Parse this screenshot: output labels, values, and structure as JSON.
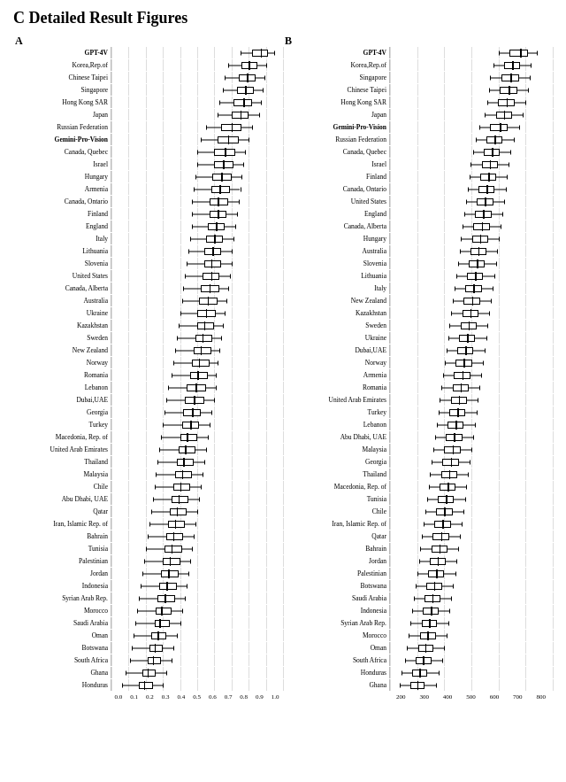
{
  "title": "C   Detailed Result Figures",
  "panelA": {
    "label": "A",
    "xAxis": [
      "0.0",
      "0.1",
      "0.2",
      "0.3",
      "0.4",
      "0.5",
      "0.6",
      "0.7",
      "0.8",
      "0.9",
      "1.0"
    ],
    "rows": [
      {
        "label": "GPT-4V",
        "q1": 0.82,
        "median": 0.87,
        "q3": 0.91,
        "wlo": 0.75,
        "whi": 0.95,
        "highlight": true
      },
      {
        "label": "Korea,Rep.of",
        "q1": 0.76,
        "median": 0.8,
        "q3": 0.85,
        "wlo": 0.68,
        "whi": 0.9
      },
      {
        "label": "Chinese Taipei",
        "q1": 0.74,
        "median": 0.79,
        "q3": 0.84,
        "wlo": 0.66,
        "whi": 0.89
      },
      {
        "label": "Singapore",
        "q1": 0.73,
        "median": 0.78,
        "q3": 0.83,
        "wlo": 0.65,
        "whi": 0.88
      },
      {
        "label": "Hong Kong SAR",
        "q1": 0.71,
        "median": 0.77,
        "q3": 0.82,
        "wlo": 0.63,
        "whi": 0.87
      },
      {
        "label": "Japan",
        "q1": 0.7,
        "median": 0.75,
        "q3": 0.8,
        "wlo": 0.62,
        "whi": 0.86
      },
      {
        "label": "Russian Federation",
        "q1": 0.64,
        "median": 0.7,
        "q3": 0.76,
        "wlo": 0.55,
        "whi": 0.82
      },
      {
        "label": "Gemini-Pro-Vision",
        "q1": 0.62,
        "median": 0.68,
        "q3": 0.74,
        "wlo": 0.52,
        "whi": 0.8,
        "highlight": true
      },
      {
        "label": "Canada, Quebec",
        "q1": 0.6,
        "median": 0.66,
        "q3": 0.72,
        "wlo": 0.5,
        "whi": 0.78
      },
      {
        "label": "Israel",
        "q1": 0.6,
        "median": 0.65,
        "q3": 0.71,
        "wlo": 0.5,
        "whi": 0.77
      },
      {
        "label": "Hungary",
        "q1": 0.59,
        "median": 0.64,
        "q3": 0.7,
        "wlo": 0.49,
        "whi": 0.76
      },
      {
        "label": "Armenia",
        "q1": 0.58,
        "median": 0.63,
        "q3": 0.69,
        "wlo": 0.48,
        "whi": 0.75
      },
      {
        "label": "Canada, Ontario",
        "q1": 0.57,
        "median": 0.62,
        "q3": 0.68,
        "wlo": 0.47,
        "whi": 0.74
      },
      {
        "label": "Finland",
        "q1": 0.57,
        "median": 0.62,
        "q3": 0.67,
        "wlo": 0.47,
        "whi": 0.73
      },
      {
        "label": "England",
        "q1": 0.56,
        "median": 0.61,
        "q3": 0.66,
        "wlo": 0.47,
        "whi": 0.72
      },
      {
        "label": "Italy",
        "q1": 0.55,
        "median": 0.6,
        "q3": 0.65,
        "wlo": 0.46,
        "whi": 0.71
      },
      {
        "label": "Lithuania",
        "q1": 0.54,
        "median": 0.59,
        "q3": 0.64,
        "wlo": 0.45,
        "whi": 0.7
      },
      {
        "label": "Slovenia",
        "q1": 0.54,
        "median": 0.58,
        "q3": 0.64,
        "wlo": 0.44,
        "whi": 0.7
      },
      {
        "label": "United States",
        "q1": 0.53,
        "median": 0.58,
        "q3": 0.63,
        "wlo": 0.43,
        "whi": 0.69
      },
      {
        "label": "Canada, Alberta",
        "q1": 0.52,
        "median": 0.57,
        "q3": 0.63,
        "wlo": 0.42,
        "whi": 0.68
      },
      {
        "label": "Australia",
        "q1": 0.51,
        "median": 0.56,
        "q3": 0.62,
        "wlo": 0.41,
        "whi": 0.67
      },
      {
        "label": "Ukraine",
        "q1": 0.5,
        "median": 0.55,
        "q3": 0.61,
        "wlo": 0.4,
        "whi": 0.66
      },
      {
        "label": "Kazakhstan",
        "q1": 0.5,
        "median": 0.54,
        "q3": 0.6,
        "wlo": 0.39,
        "whi": 0.65
      },
      {
        "label": "Sweden",
        "q1": 0.49,
        "median": 0.53,
        "q3": 0.59,
        "wlo": 0.38,
        "whi": 0.64
      },
      {
        "label": "New Zealand",
        "q1": 0.48,
        "median": 0.52,
        "q3": 0.58,
        "wlo": 0.37,
        "whi": 0.63
      },
      {
        "label": "Norway",
        "q1": 0.47,
        "median": 0.51,
        "q3": 0.57,
        "wlo": 0.36,
        "whi": 0.62
      },
      {
        "label": "Romania",
        "q1": 0.46,
        "median": 0.5,
        "q3": 0.56,
        "wlo": 0.35,
        "whi": 0.61
      },
      {
        "label": "Lebanon",
        "q1": 0.44,
        "median": 0.49,
        "q3": 0.55,
        "wlo": 0.33,
        "whi": 0.61
      },
      {
        "label": "Dubai,UAE",
        "q1": 0.43,
        "median": 0.48,
        "q3": 0.54,
        "wlo": 0.32,
        "whi": 0.6
      },
      {
        "label": "Georgia",
        "q1": 0.42,
        "median": 0.47,
        "q3": 0.52,
        "wlo": 0.31,
        "whi": 0.58
      },
      {
        "label": "Turkey",
        "q1": 0.41,
        "median": 0.46,
        "q3": 0.51,
        "wlo": 0.3,
        "whi": 0.57
      },
      {
        "label": "Macedonia, Rep. of",
        "q1": 0.4,
        "median": 0.44,
        "q3": 0.5,
        "wlo": 0.29,
        "whi": 0.56
      },
      {
        "label": "United Arab Emirates",
        "q1": 0.39,
        "median": 0.43,
        "q3": 0.49,
        "wlo": 0.28,
        "whi": 0.55
      },
      {
        "label": "Thailand",
        "q1": 0.38,
        "median": 0.42,
        "q3": 0.48,
        "wlo": 0.27,
        "whi": 0.54
      },
      {
        "label": "Malaysia",
        "q1": 0.37,
        "median": 0.41,
        "q3": 0.47,
        "wlo": 0.26,
        "whi": 0.53
      },
      {
        "label": "Chile",
        "q1": 0.36,
        "median": 0.4,
        "q3": 0.46,
        "wlo": 0.25,
        "whi": 0.52
      },
      {
        "label": "Abu Dhabi, UAE",
        "q1": 0.35,
        "median": 0.39,
        "q3": 0.45,
        "wlo": 0.24,
        "whi": 0.51
      },
      {
        "label": "Qatar",
        "q1": 0.34,
        "median": 0.38,
        "q3": 0.44,
        "wlo": 0.23,
        "whi": 0.5
      },
      {
        "label": "Iran, Islamic Rep. of",
        "q1": 0.33,
        "median": 0.37,
        "q3": 0.43,
        "wlo": 0.22,
        "whi": 0.49
      },
      {
        "label": "Bahrain",
        "q1": 0.32,
        "median": 0.36,
        "q3": 0.42,
        "wlo": 0.21,
        "whi": 0.48
      },
      {
        "label": "Tunisia",
        "q1": 0.31,
        "median": 0.35,
        "q3": 0.41,
        "wlo": 0.2,
        "whi": 0.47
      },
      {
        "label": "Palestinian",
        "q1": 0.3,
        "median": 0.34,
        "q3": 0.4,
        "wlo": 0.19,
        "whi": 0.46
      },
      {
        "label": "Jordan",
        "q1": 0.29,
        "median": 0.33,
        "q3": 0.39,
        "wlo": 0.18,
        "whi": 0.45
      },
      {
        "label": "Indonesia",
        "q1": 0.28,
        "median": 0.32,
        "q3": 0.38,
        "wlo": 0.17,
        "whi": 0.44
      },
      {
        "label": "Syrian Arab Rep.",
        "q1": 0.27,
        "median": 0.31,
        "q3": 0.37,
        "wlo": 0.16,
        "whi": 0.43
      },
      {
        "label": "Morocco",
        "q1": 0.26,
        "median": 0.29,
        "q3": 0.35,
        "wlo": 0.15,
        "whi": 0.41
      },
      {
        "label": "Saudi Arabia",
        "q1": 0.25,
        "median": 0.28,
        "q3": 0.34,
        "wlo": 0.14,
        "whi": 0.4
      },
      {
        "label": "Oman",
        "q1": 0.23,
        "median": 0.27,
        "q3": 0.32,
        "wlo": 0.13,
        "whi": 0.38
      },
      {
        "label": "Botswana",
        "q1": 0.22,
        "median": 0.25,
        "q3": 0.3,
        "wlo": 0.12,
        "whi": 0.36
      },
      {
        "label": "South Africa",
        "q1": 0.21,
        "median": 0.24,
        "q3": 0.29,
        "wlo": 0.11,
        "whi": 0.35
      },
      {
        "label": "Ghana",
        "q1": 0.18,
        "median": 0.21,
        "q3": 0.26,
        "wlo": 0.08,
        "whi": 0.32
      },
      {
        "label": "Honduras",
        "q1": 0.16,
        "median": 0.19,
        "q3": 0.24,
        "wlo": 0.06,
        "whi": 0.3
      }
    ]
  },
  "panelB": {
    "label": "B",
    "xAxis": [
      "200",
      "300",
      "400",
      "500",
      "600",
      "700",
      "800"
    ],
    "xMin": 200,
    "xMax": 800,
    "rows": [
      {
        "label": "GPT-4V",
        "q1": 640,
        "median": 680,
        "q3": 710,
        "wlo": 600,
        "whi": 740,
        "highlight": true
      },
      {
        "label": "Korea,Rep.of",
        "q1": 620,
        "median": 650,
        "q3": 680,
        "wlo": 580,
        "whi": 720
      },
      {
        "label": "Singapore",
        "q1": 610,
        "median": 645,
        "q3": 675,
        "wlo": 570,
        "whi": 715
      },
      {
        "label": "Chinese Taipei",
        "q1": 605,
        "median": 638,
        "q3": 668,
        "wlo": 565,
        "whi": 708
      },
      {
        "label": "Hong Kong SAR",
        "q1": 598,
        "median": 630,
        "q3": 660,
        "wlo": 558,
        "whi": 700
      },
      {
        "label": "Japan",
        "q1": 590,
        "median": 620,
        "q3": 650,
        "wlo": 550,
        "whi": 690
      },
      {
        "label": "Gemini-Pro-Vision",
        "q1": 570,
        "median": 605,
        "q3": 635,
        "wlo": 530,
        "whi": 675,
        "highlight": true
      },
      {
        "label": "Russian Federation",
        "q1": 555,
        "median": 585,
        "q3": 615,
        "wlo": 515,
        "whi": 655
      },
      {
        "label": "Canada, Quebec",
        "q1": 545,
        "median": 575,
        "q3": 605,
        "wlo": 505,
        "whi": 645
      },
      {
        "label": "Israel",
        "q1": 538,
        "median": 568,
        "q3": 598,
        "wlo": 498,
        "whi": 638
      },
      {
        "label": "Finland",
        "q1": 532,
        "median": 562,
        "q3": 592,
        "wlo": 492,
        "whi": 632
      },
      {
        "label": "Canada, Ontario",
        "q1": 526,
        "median": 556,
        "q3": 586,
        "wlo": 486,
        "whi": 626
      },
      {
        "label": "United States",
        "q1": 520,
        "median": 550,
        "q3": 580,
        "wlo": 480,
        "whi": 620
      },
      {
        "label": "England",
        "q1": 514,
        "median": 544,
        "q3": 574,
        "wlo": 474,
        "whi": 614
      },
      {
        "label": "Canada, Alberta",
        "q1": 508,
        "median": 538,
        "q3": 568,
        "wlo": 468,
        "whi": 608
      },
      {
        "label": "Hungary",
        "q1": 502,
        "median": 532,
        "q3": 562,
        "wlo": 462,
        "whi": 602
      },
      {
        "label": "Australia",
        "q1": 496,
        "median": 526,
        "q3": 556,
        "wlo": 456,
        "whi": 596
      },
      {
        "label": "Slovenia",
        "q1": 490,
        "median": 520,
        "q3": 550,
        "wlo": 450,
        "whi": 590
      },
      {
        "label": "Lithuania",
        "q1": 484,
        "median": 514,
        "q3": 544,
        "wlo": 444,
        "whi": 584
      },
      {
        "label": "Italy",
        "q1": 478,
        "median": 508,
        "q3": 538,
        "wlo": 438,
        "whi": 578
      },
      {
        "label": "New Zealand",
        "q1": 472,
        "median": 502,
        "q3": 532,
        "wlo": 432,
        "whi": 572
      },
      {
        "label": "Kazakhstan",
        "q1": 466,
        "median": 496,
        "q3": 526,
        "wlo": 426,
        "whi": 566
      },
      {
        "label": "Sweden",
        "q1": 460,
        "median": 490,
        "q3": 520,
        "wlo": 420,
        "whi": 560
      },
      {
        "label": "Ukraine",
        "q1": 454,
        "median": 484,
        "q3": 514,
        "wlo": 414,
        "whi": 554
      },
      {
        "label": "Dubai,UAE",
        "q1": 448,
        "median": 478,
        "q3": 508,
        "wlo": 408,
        "whi": 548
      },
      {
        "label": "Norway",
        "q1": 442,
        "median": 472,
        "q3": 502,
        "wlo": 402,
        "whi": 542
      },
      {
        "label": "Armenia",
        "q1": 436,
        "median": 466,
        "q3": 496,
        "wlo": 396,
        "whi": 536
      },
      {
        "label": "Romania",
        "q1": 430,
        "median": 460,
        "q3": 490,
        "wlo": 390,
        "whi": 530
      },
      {
        "label": "United Arab Emirates",
        "q1": 424,
        "median": 454,
        "q3": 484,
        "wlo": 384,
        "whi": 524
      },
      {
        "label": "Turkey",
        "q1": 418,
        "median": 448,
        "q3": 478,
        "wlo": 378,
        "whi": 518
      },
      {
        "label": "Lebanon",
        "q1": 412,
        "median": 442,
        "q3": 472,
        "wlo": 372,
        "whi": 512
      },
      {
        "label": "Abu Dhabi, UAE",
        "q1": 406,
        "median": 436,
        "q3": 466,
        "wlo": 366,
        "whi": 506
      },
      {
        "label": "Malaysia",
        "q1": 400,
        "median": 430,
        "q3": 460,
        "wlo": 360,
        "whi": 500
      },
      {
        "label": "Georgia",
        "q1": 394,
        "median": 424,
        "q3": 454,
        "wlo": 354,
        "whi": 494
      },
      {
        "label": "Thailand",
        "q1": 388,
        "median": 418,
        "q3": 448,
        "wlo": 348,
        "whi": 488
      },
      {
        "label": "Macedonia, Rep. of",
        "q1": 382,
        "median": 412,
        "q3": 442,
        "wlo": 342,
        "whi": 482
      },
      {
        "label": "Tunisia",
        "q1": 376,
        "median": 406,
        "q3": 436,
        "wlo": 336,
        "whi": 476
      },
      {
        "label": "Chile",
        "q1": 370,
        "median": 400,
        "q3": 430,
        "wlo": 330,
        "whi": 470
      },
      {
        "label": "Iran, Islamic Rep. of",
        "q1": 364,
        "median": 394,
        "q3": 424,
        "wlo": 324,
        "whi": 464
      },
      {
        "label": "Qatar",
        "q1": 358,
        "median": 388,
        "q3": 418,
        "wlo": 318,
        "whi": 458
      },
      {
        "label": "Bahrain",
        "q1": 352,
        "median": 382,
        "q3": 412,
        "wlo": 312,
        "whi": 452
      },
      {
        "label": "Jordan",
        "q1": 346,
        "median": 376,
        "q3": 406,
        "wlo": 306,
        "whi": 446
      },
      {
        "label": "Palestinian",
        "q1": 340,
        "median": 370,
        "q3": 400,
        "wlo": 300,
        "whi": 440
      },
      {
        "label": "Botswana",
        "q1": 334,
        "median": 362,
        "q3": 392,
        "wlo": 294,
        "whi": 432
      },
      {
        "label": "Saudi Arabia",
        "q1": 328,
        "median": 356,
        "q3": 386,
        "wlo": 288,
        "whi": 426
      },
      {
        "label": "Indonesia",
        "q1": 322,
        "median": 350,
        "q3": 380,
        "wlo": 282,
        "whi": 420
      },
      {
        "label": "Syrian Arab Rep.",
        "q1": 316,
        "median": 344,
        "q3": 374,
        "wlo": 276,
        "whi": 414
      },
      {
        "label": "Morocco",
        "q1": 310,
        "median": 338,
        "q3": 368,
        "wlo": 270,
        "whi": 408
      },
      {
        "label": "Oman",
        "q1": 303,
        "median": 330,
        "q3": 360,
        "wlo": 263,
        "whi": 400
      },
      {
        "label": "South Africa",
        "q1": 296,
        "median": 322,
        "q3": 352,
        "wlo": 256,
        "whi": 392
      },
      {
        "label": "Honduras",
        "q1": 283,
        "median": 308,
        "q3": 338,
        "wlo": 243,
        "whi": 378
      },
      {
        "label": "Ghana",
        "q1": 275,
        "median": 300,
        "q3": 328,
        "wlo": 235,
        "whi": 368
      }
    ]
  }
}
